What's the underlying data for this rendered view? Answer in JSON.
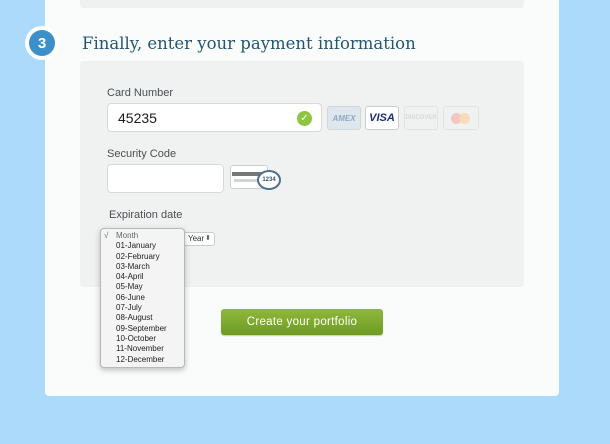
{
  "step": {
    "number": "3",
    "title": "Finally, enter your payment information"
  },
  "card_number": {
    "label": "Card Number",
    "value": "45235"
  },
  "card_logos": {
    "amex": "AMEX",
    "visa": "VISA",
    "discover": "DISCOVER"
  },
  "security_code": {
    "label": "Security Code",
    "value": "",
    "cvv_hint": "1234"
  },
  "expiration": {
    "label": "Expiration date",
    "year_select": "Year",
    "month_options": [
      "Month",
      "01-January",
      "02-February",
      "03-March",
      "04-April",
      "05-May",
      "06-June",
      "07-July",
      "08-August",
      "09-September",
      "10-October",
      "11-November",
      "12-December"
    ],
    "selected_month": "Month",
    "selected_mark": "√"
  },
  "cta": {
    "label": "Create your portfolio"
  },
  "colors": {
    "background": "#abdafb",
    "accent_green": "#7fa92f",
    "step_blue": "#3c8fc9",
    "title": "#23576f"
  }
}
